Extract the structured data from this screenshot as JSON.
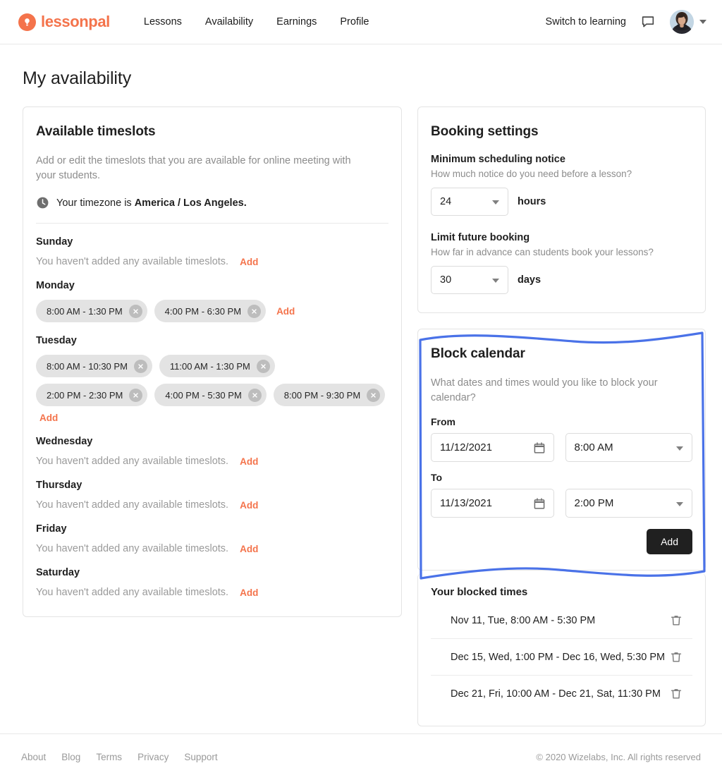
{
  "header": {
    "brand_name": "lessonpal",
    "brand_color": "#f4734b",
    "nav": [
      {
        "label": "Lessons"
      },
      {
        "label": "Availability"
      },
      {
        "label": "Earnings"
      },
      {
        "label": "Profile"
      }
    ],
    "switch_label": "Switch to learning",
    "chat_icon": "chat-bubble-icon",
    "avatar_icon": "user-avatar",
    "caret_icon": "chevron-down-icon"
  },
  "page_title": "My availability",
  "timeslots": {
    "title": "Available timeslots",
    "description": "Add or edit the timeslots that you are available for online meeting with your students.",
    "timezone_prefix": "Your timezone is ",
    "timezone_value": "America / Los Angeles.",
    "timezone_icon": "clock-icon",
    "empty_text": "You haven't added any available timeslots.",
    "add_label": "Add",
    "remove_icon": "close-circle-icon",
    "days": [
      {
        "name": "Sunday",
        "slots": []
      },
      {
        "name": "Monday",
        "slots": [
          "8:00 AM - 1:30 PM",
          "4:00 PM - 6:30 PM"
        ]
      },
      {
        "name": "Tuesday",
        "slots": [
          "8:00 AM - 10:30 PM",
          "11:00 AM - 1:30 PM",
          "2:00 PM - 2:30 PM",
          "4:00 PM - 5:30 PM",
          "8:00 PM - 9:30 PM"
        ]
      },
      {
        "name": "Wednesday",
        "slots": []
      },
      {
        "name": "Thursday",
        "slots": []
      },
      {
        "name": "Friday",
        "slots": []
      },
      {
        "name": "Saturday",
        "slots": []
      }
    ]
  },
  "booking": {
    "title": "Booking settings",
    "min_notice": {
      "label": "Minimum scheduling notice",
      "help": "How much notice do you need before a lesson?",
      "value": "24",
      "unit": "hours"
    },
    "limit_future": {
      "label": "Limit future booking",
      "help": "How far in advance can students book your lessons?",
      "value": "30",
      "unit": "days"
    },
    "dropdown_icon": "chevron-down-icon"
  },
  "block_calendar": {
    "title": "Block calendar",
    "description": "What dates and times would you like to block your calendar?",
    "from_label": "From",
    "to_label": "To",
    "from_date": "11/12/2021",
    "from_time": "8:00 AM",
    "to_date": "11/13/2021",
    "to_time": "2:00 PM",
    "add_button": "Add",
    "calendar_icon": "calendar-icon",
    "dropdown_icon": "chevron-down-icon",
    "highlight_color": "#4a72e8"
  },
  "blocked_times": {
    "title": "Your blocked times",
    "delete_icon": "trash-icon",
    "rows": [
      {
        "text": "Nov 11, Tue, 8:00 AM - 5:30 PM"
      },
      {
        "text": "Dec 15, Wed, 1:00 PM - Dec 16, Wed, 5:30 PM"
      },
      {
        "text": "Dec 21, Fri, 10:00 AM - Dec 21, Sat, 11:30 PM"
      }
    ]
  },
  "footer": {
    "links": [
      {
        "label": "About"
      },
      {
        "label": "Blog"
      },
      {
        "label": "Terms"
      },
      {
        "label": "Privacy"
      },
      {
        "label": "Support"
      }
    ],
    "copyright": "© 2020 Wizelabs, Inc. All rights reserved"
  }
}
